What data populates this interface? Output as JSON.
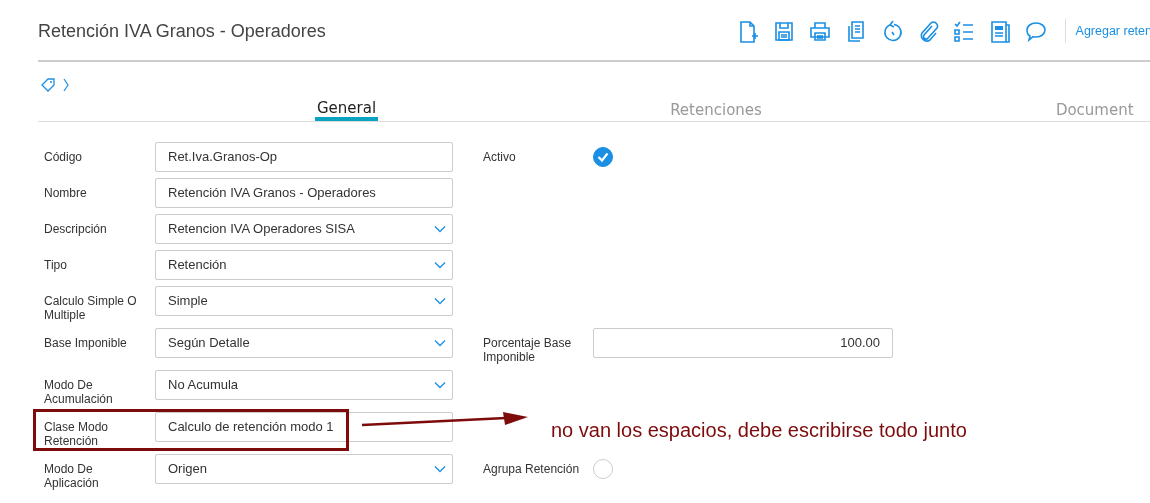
{
  "window": {
    "title": "Retención IVA Granos - Operadores"
  },
  "toolbar": {
    "link": "Agregar reten"
  },
  "tabs": [
    {
      "label": "General",
      "selected": true
    },
    {
      "label": "Retenciones",
      "selected": false
    },
    {
      "label": "Document",
      "selected": false
    }
  ],
  "form": {
    "rows": [
      {
        "label": "Código",
        "kind": "text",
        "value": "Ret.Iva.Granos-Op",
        "side": {
          "label": "Activo",
          "kind": "checkbox",
          "checked": true
        }
      },
      {
        "label": "Nombre",
        "kind": "text",
        "value": "Retención IVA Granos - Operadores"
      },
      {
        "label": "Descripción",
        "kind": "select",
        "value": "Retencion IVA Operadores SISA"
      },
      {
        "label": "Tipo",
        "kind": "select",
        "value": "Retención"
      },
      {
        "label": "Calculo Simple O Multiple",
        "kind": "select",
        "value": "Simple"
      },
      {
        "label": "Base Imponible",
        "kind": "select",
        "value": "Según Detalle",
        "side": {
          "label": "Porcentaje Base Imponible",
          "kind": "number",
          "value": "100.00"
        }
      },
      {
        "label": "Modo De Acumulación",
        "kind": "select",
        "value": "No Acumula"
      },
      {
        "label": "Clase Modo Retención",
        "kind": "text",
        "value": "Calculo de retención modo 1",
        "highlighted": true,
        "note": "no van los espacios, debe escribirse todo junto"
      },
      {
        "label": "Modo De Aplicación",
        "kind": "select",
        "value": "Origen",
        "side": {
          "label": "Agrupa Retención",
          "kind": "checkbox",
          "checked": false
        }
      }
    ]
  }
}
